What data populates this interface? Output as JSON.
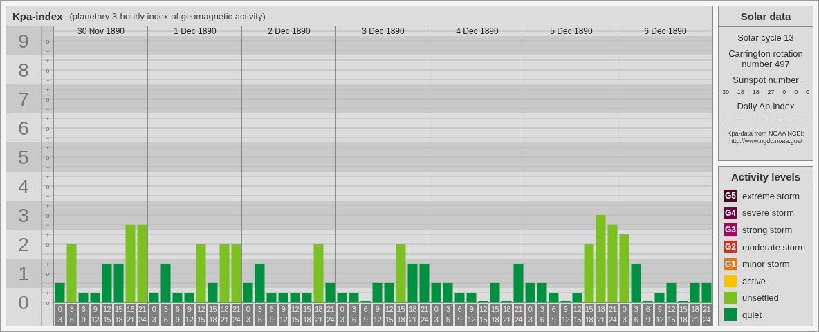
{
  "panel": {
    "title": "Kpa-index",
    "subtitle": "(planetary 3-hourly index of geomagnetic activity)",
    "days": [
      "30 Nov 1890",
      "1 Dec 1890",
      "2 Dec 1890",
      "3 Dec 1890",
      "4 Dec 1890",
      "5 Dec 1890",
      "6 Dec 1890"
    ],
    "subticks": [
      "o",
      "−",
      "+",
      "o",
      "−",
      "+",
      "o",
      "−",
      "+",
      "o",
      "−",
      "+",
      "o",
      "−",
      "+",
      "o",
      "−",
      "+",
      "o",
      "−",
      "+",
      "o",
      "−",
      "+",
      "o",
      "−",
      "+",
      "o"
    ],
    "chart_data": {
      "type": "bar",
      "stacked": true,
      "ylim": [
        0,
        9.5
      ],
      "yticks": [
        0,
        1,
        2,
        3,
        4,
        5,
        6,
        7,
        8,
        9
      ],
      "grid": true,
      "categories": [
        "0\n3",
        "3\n6",
        "6\n9",
        "9\n12",
        "12\n15",
        "15\n18",
        "18\n21",
        "21\n24",
        "0\n3",
        "3\n6",
        "6\n9",
        "9\n12",
        "12\n15",
        "15\n18",
        "18\n21",
        "21\n24",
        "0\n3",
        "3\n6",
        "6\n9",
        "9\n12",
        "12\n15",
        "15\n18",
        "18\n21",
        "21\n24",
        "0\n3",
        "3\n6",
        "6\n9",
        "9\n12",
        "12\n15",
        "15\n18",
        "18\n21",
        "21\n24",
        "0\n3",
        "3\n6",
        "6\n9",
        "9\n12",
        "12\n15",
        "15\n18",
        "18\n21",
        "21\n24",
        "0\n3",
        "3\n6",
        "6\n9",
        "9\n12",
        "12\n15",
        "15\n18",
        "18\n21",
        "21\n24",
        "0\n3",
        "3\n6",
        "6\n9",
        "9\n12",
        "12\n15",
        "15\n18",
        "18\n21",
        "21\n24"
      ],
      "series": [
        {
          "color": "#009140",
          "values": [
            0.67,
            null,
            0.33,
            0.33,
            1.33,
            1.33,
            null,
            null,
            0.33,
            1.33,
            0.33,
            0.33,
            null,
            0.67,
            null,
            null,
            0.67,
            1.33,
            0.33,
            0.33,
            0.33,
            0.33,
            null,
            0.67,
            0.33,
            0.33,
            0,
            0.67,
            0.67,
            null,
            1.33,
            1.33,
            0.67,
            0.67,
            0.33,
            0.33,
            0,
            0.67,
            0,
            1.33,
            0.67,
            0.67,
            0.33,
            0,
            0.33,
            null,
            null,
            null,
            null,
            1.33,
            0,
            0.33,
            0.67,
            0,
            0.67,
            0.67
          ]
        },
        {
          "color": "#7ac121",
          "values": [
            null,
            2,
            null,
            null,
            null,
            null,
            2.67,
            2.67,
            null,
            null,
            null,
            null,
            2,
            null,
            2,
            2,
            null,
            null,
            null,
            null,
            null,
            null,
            2,
            null,
            null,
            null,
            null,
            null,
            null,
            2,
            null,
            null,
            null,
            null,
            null,
            null,
            null,
            null,
            null,
            null,
            null,
            null,
            null,
            null,
            null,
            2,
            3,
            2.67,
            2.33,
            null,
            null,
            null,
            null,
            null,
            null,
            null
          ]
        }
      ]
    }
  },
  "solar_data": {
    "title": "Solar data",
    "solar_cycle": "Solar cycle 13",
    "carrington": "Carrington rotation number 497",
    "sunspot_label": "Sunspot number",
    "sunspot_numbers": [
      "30",
      "18",
      "18",
      "27",
      "0",
      "0",
      "0"
    ],
    "ap_label": "Daily Ap-index",
    "ap_values": [
      "--",
      "--",
      "--",
      "--",
      "--",
      "--",
      "--"
    ],
    "source_lines": [
      "Kpa-data from NOAA NCEI:",
      "http://www.ngdc.noaa.gov/"
    ]
  },
  "activity_levels": {
    "title": "Activity levels",
    "items": [
      {
        "badge": "G5",
        "label": "extreme storm",
        "color": "#4b0025"
      },
      {
        "badge": "G4",
        "label": "severe storm",
        "color": "#700040"
      },
      {
        "badge": "G3",
        "label": "strong storm",
        "color": "#b2005e"
      },
      {
        "badge": "G2",
        "label": "moderate storm",
        "color": "#d92b1c"
      },
      {
        "badge": "G1",
        "label": "minor storm",
        "color": "#e8761b"
      },
      {
        "label": "active",
        "color": "#fdc300"
      },
      {
        "label": "unsettled",
        "color": "#7ac121"
      },
      {
        "label": "quiet",
        "color": "#009140"
      }
    ]
  }
}
